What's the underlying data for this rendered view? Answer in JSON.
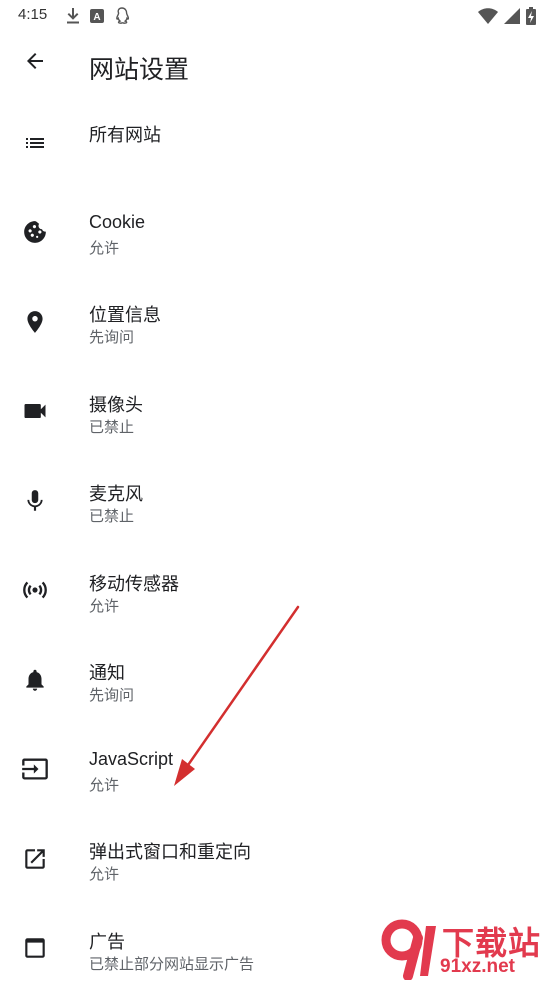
{
  "status_bar": {
    "time": "4:15",
    "left_icons": [
      "download-icon",
      "a-keyboard-icon",
      "qq-penguin-icon"
    ],
    "right_icons": [
      "wifi-icon",
      "cell-signal-icon",
      "battery-charging-icon"
    ]
  },
  "header": {
    "title": "网站设置",
    "back_icon": "arrow-back-icon"
  },
  "settings": [
    {
      "id": "all-sites",
      "icon": "list-icon",
      "title": "所有网站",
      "subtitle": ""
    },
    {
      "id": "cookie",
      "icon": "cookie-icon",
      "title": "Cookie",
      "subtitle": "允许"
    },
    {
      "id": "location",
      "icon": "location-pin-icon",
      "title": "位置信息",
      "subtitle": "先询问"
    },
    {
      "id": "camera",
      "icon": "videocam-icon",
      "title": "摄像头",
      "subtitle": "已禁止"
    },
    {
      "id": "microphone",
      "icon": "mic-icon",
      "title": "麦克风",
      "subtitle": "已禁止"
    },
    {
      "id": "motion-sensors",
      "icon": "sensors-icon",
      "title": "移动传感器",
      "subtitle": "允许"
    },
    {
      "id": "notifications",
      "icon": "bell-icon",
      "title": "通知",
      "subtitle": "先询问"
    },
    {
      "id": "javascript",
      "icon": "input-icon",
      "title": "JavaScript",
      "subtitle": "允许"
    },
    {
      "id": "popups",
      "icon": "open-in-new-icon",
      "title": "弹出式窗口和重定向",
      "subtitle": "允许"
    },
    {
      "id": "ads",
      "icon": "web-asset-icon",
      "title": "广告",
      "subtitle": "已禁止部分网站显示广告"
    }
  ],
  "annotation": {
    "arrow_color": "#d32f2f"
  },
  "watermark": {
    "top": "下载站",
    "bottom": "91xz.net",
    "logo": "91"
  },
  "colors": {
    "text": "#202124",
    "subtext": "#5f6368",
    "icon": "#202124",
    "watermark": "#e23a4e"
  }
}
